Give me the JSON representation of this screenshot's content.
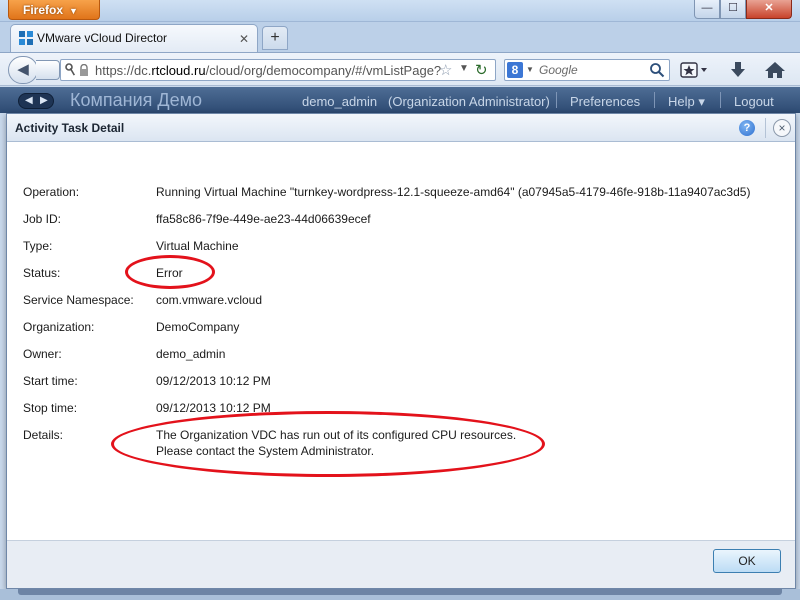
{
  "browser": {
    "app_button": "Firefox",
    "tab_title": "VMware vCloud Director",
    "url_prefix": "https://dc.",
    "url_domain": "rtcloud.ru",
    "url_path": "/cloud/org/democompany/#/vmListPage?",
    "search_placeholder": "Google",
    "search_engine_letter": "8"
  },
  "app_header": {
    "org_name": "Компания Демо",
    "user": "demo_admin",
    "role": "(Organization Administrator)",
    "preferences": "Preferences",
    "help": "Help ▾",
    "logout": "Logout"
  },
  "dialog": {
    "title": "Activity Task Detail",
    "help_glyph": "?",
    "close_glyph": "×",
    "fields": {
      "operation": {
        "label": "Operation:",
        "value": "Running Virtual Machine \"turnkey-wordpress-12.1-squeeze-amd64\" (a07945a5-4179-46fe-918b-11a9407ac3d5)"
      },
      "job_id": {
        "label": "Job ID:",
        "value": "ffa58c86-7f9e-449e-ae23-44d06639ecef"
      },
      "type": {
        "label": "Type:",
        "value": "Virtual Machine"
      },
      "status": {
        "label": "Status:",
        "value": "Error"
      },
      "namespace": {
        "label": "Service Namespace:",
        "value": "com.vmware.vcloud"
      },
      "organization": {
        "label": "Organization:",
        "value": "DemoCompany"
      },
      "owner": {
        "label": "Owner:",
        "value": "demo_admin"
      },
      "start_time": {
        "label": "Start time:",
        "value": "09/12/2013 10:12 PM"
      },
      "stop_time": {
        "label": "Stop time:",
        "value": "09/12/2013 10:12 PM"
      },
      "details": {
        "label": "Details:",
        "line1": "The Organization VDC has run out of its configured CPU resources.",
        "line2": "Please contact the System Administrator."
      }
    },
    "ok_label": "OK"
  },
  "colors": {
    "annotation": "#e3121b",
    "header_bg": "#3b5a82",
    "firefox_orange": "#e67f22"
  }
}
